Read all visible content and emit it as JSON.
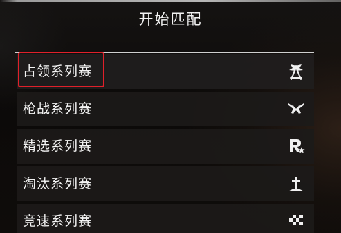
{
  "header": {
    "title": "开始匹配"
  },
  "menu": {
    "items": [
      {
        "label": "占领系列赛",
        "icon": "crossed-flags-icon",
        "selected": true
      },
      {
        "label": "枪战系列赛",
        "icon": "crossed-revolvers-icon",
        "selected": false
      },
      {
        "label": "精选系列赛",
        "icon": "rockstar-r-icon",
        "selected": false
      },
      {
        "label": "淘汰系列赛",
        "icon": "grave-cross-icon",
        "selected": false
      },
      {
        "label": "竞速系列赛",
        "icon": "checkered-flag-icon",
        "selected": false
      }
    ]
  },
  "colors": {
    "highlight": "#e0202a",
    "text": "#f3f3f3",
    "item_background": "#1c1a19"
  }
}
